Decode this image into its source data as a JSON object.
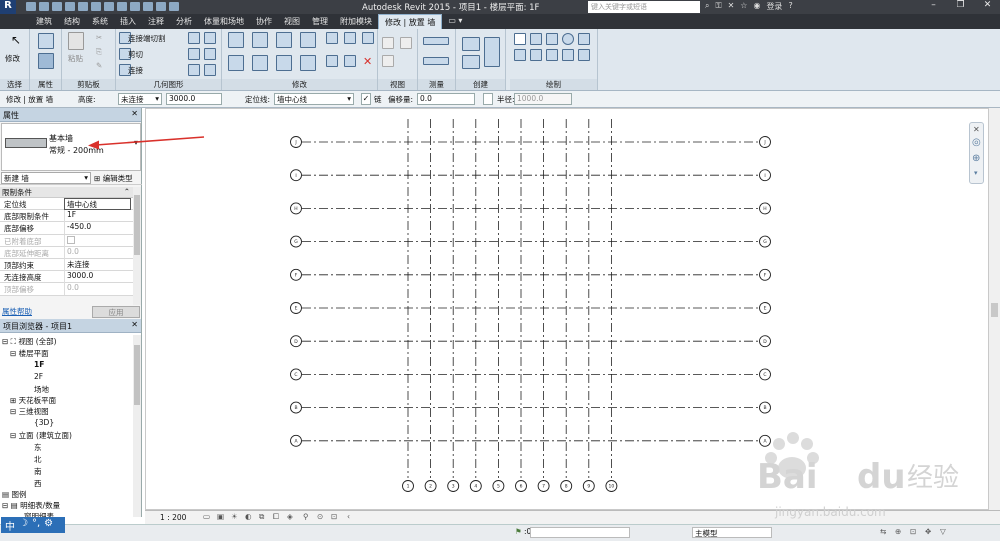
{
  "titlebar": {
    "title": "Autodesk Revit 2015 -  项目1 - 楼层平面: 1F",
    "search_placeholder": "键入关键字或短语",
    "signin": "登录",
    "help": "?"
  },
  "tabs": [
    "建筑",
    "结构",
    "系统",
    "插入",
    "注释",
    "分析",
    "体量和场地",
    "协作",
    "视图",
    "管理",
    "附加模块",
    "修改 | 放置 墙"
  ],
  "ribbon": {
    "groups": [
      "选择",
      "属性",
      "剪贴板",
      "几何图形",
      "修改",
      "视图",
      "测量",
      "创建",
      "绘制"
    ],
    "modify_label": "修改",
    "paste_label": "粘贴",
    "cut_join": "连接端切割",
    "cut": "剪切",
    "join": "连接"
  },
  "optionsbar": {
    "context": "修改 | 放置 墙",
    "height_label": "高度:",
    "height_mode": "未连接",
    "height_value": "3000.0",
    "locline_label": "定位线:",
    "locline_value": "墙中心线",
    "chain_label": "链",
    "offset_label": "偏移量:",
    "offset_value": "0.0",
    "radius_label": "半径:",
    "radius_value": "1000.0"
  },
  "properties": {
    "header": "属性",
    "type_family": "基本墙",
    "type_name": "常规 - 200mm",
    "new_label": "新建 墙",
    "edit_type": "编辑类型",
    "section": "限制条件",
    "rows": [
      {
        "k": "定位线",
        "v": "墙中心线"
      },
      {
        "k": "底部限制条件",
        "v": "1F"
      },
      {
        "k": "底部偏移",
        "v": "-450.0"
      },
      {
        "k": "已附着底部",
        "v": ""
      },
      {
        "k": "底部延伸距离",
        "v": "0.0"
      },
      {
        "k": "顶部约束",
        "v": "未连接"
      },
      {
        "k": "无连接高度",
        "v": "3000.0"
      },
      {
        "k": "顶部偏移",
        "v": "0.0"
      }
    ],
    "help": "属性帮助",
    "apply": "应用"
  },
  "browser": {
    "header": "项目浏览器 - 项目1",
    "nodes": [
      "视图 (全部)",
      "楼层平面",
      "1F",
      "2F",
      "场地",
      "天花板平面",
      "三维视图",
      "{3D}",
      "立面 (建筑立面)",
      "东",
      "北",
      "南",
      "西",
      "图例",
      "明细表/数量",
      "窗明细表"
    ]
  },
  "canvas": {
    "grid_h_labels": [
      "J",
      "I",
      "H",
      "G",
      "F",
      "E",
      "D",
      "C",
      "B",
      "A"
    ],
    "grid_v_labels": [
      "1",
      "2",
      "3",
      "4",
      "5",
      "6",
      "7",
      "8",
      "9",
      "10"
    ]
  },
  "viewctl": {
    "scale": "1 : 200"
  },
  "status": {
    "model": "主模型",
    "filter": ":0"
  },
  "ime": [
    "中",
    "☽",
    "°,",
    "⚙"
  ],
  "colors": {
    "accent": "#2f3238",
    "ribbon": "#dfe7ee",
    "arrow": "#d9312b"
  }
}
